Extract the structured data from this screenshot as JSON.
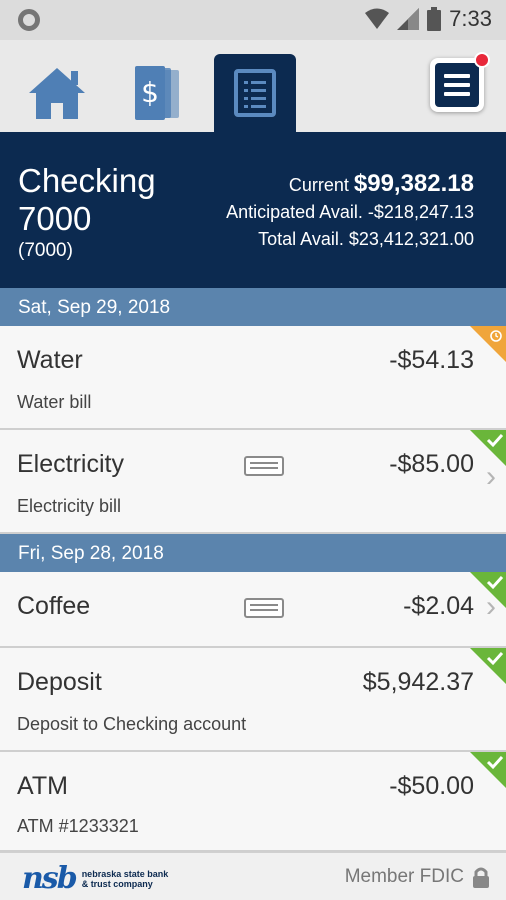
{
  "status_bar": {
    "time": "7:33"
  },
  "nav": {
    "tabs": [
      {
        "name": "home",
        "active": false
      },
      {
        "name": "accounts",
        "active": false
      },
      {
        "name": "transactions",
        "active": true
      }
    ],
    "menu_has_notification": true
  },
  "account": {
    "name": "Checking 7000",
    "number": "(7000)",
    "current_label": "Current",
    "current_value": "$99,382.18",
    "anticipated_label": "Anticipated Avail.",
    "anticipated_value": "-$218,247.13",
    "total_label": "Total Avail.",
    "total_value": "$23,412,321.00"
  },
  "groups": [
    {
      "date": "Sat, Sep 29, 2018",
      "transactions": [
        {
          "name": "Water",
          "description": "Water bill",
          "amount": "-$54.13",
          "status": "pending",
          "receipt": false,
          "chevron": false
        },
        {
          "name": "Electricity",
          "description": "Electricity bill",
          "amount": "-$85.00",
          "status": "cleared",
          "receipt": true,
          "chevron": true
        }
      ]
    },
    {
      "date": "Fri, Sep 28, 2018",
      "transactions": [
        {
          "name": "Coffee",
          "description": "",
          "amount": "-$2.04",
          "status": "cleared",
          "receipt": true,
          "chevron": true
        },
        {
          "name": "Deposit",
          "description": "Deposit to Checking account",
          "amount": "$5,942.37",
          "status": "cleared",
          "receipt": false,
          "chevron": false
        },
        {
          "name": "ATM",
          "description": "ATM #1233321",
          "amount": "-$50.00",
          "status": "cleared",
          "receipt": false,
          "chevron": false
        }
      ]
    }
  ],
  "footer": {
    "logo_mark": "nsb",
    "logo_line1": "nebraska state bank",
    "logo_line2": "& trust company",
    "member_text": "Member FDIC"
  },
  "colors": {
    "navy": "#0c2a50",
    "date_header": "#5b84ad",
    "cleared": "#6ab63a",
    "pending": "#f0a53a",
    "notification": "#e8283a"
  },
  "icons": {
    "chevron": "›"
  }
}
